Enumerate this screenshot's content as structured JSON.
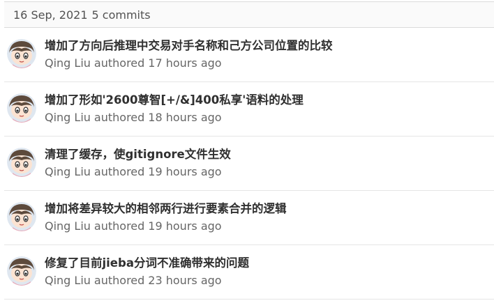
{
  "day_header": {
    "date": "16 Sep, 2021",
    "commit_count": "5 commits"
  },
  "commits": [
    {
      "title": "增加了方向后推理中交易对手名称和己方公司位置的比较",
      "author": "Qing Liu",
      "action": "authored",
      "time": "17 hours ago"
    },
    {
      "title": "增加了形如'2600尊智[+/&]400私享'语料的处理",
      "author": "Qing Liu",
      "action": "authored",
      "time": "18 hours ago"
    },
    {
      "title": "清理了缓存，使gitignore文件生效",
      "author": "Qing Liu",
      "action": "authored",
      "time": "19 hours ago"
    },
    {
      "title": "增加将差异较大的相邻两行进行要素合并的逻辑",
      "author": "Qing Liu",
      "action": "authored",
      "time": "19 hours ago"
    },
    {
      "title": "修复了目前jieba分词不准确带来的问题",
      "author": "Qing Liu",
      "action": "authored",
      "time": "23 hours ago"
    }
  ]
}
